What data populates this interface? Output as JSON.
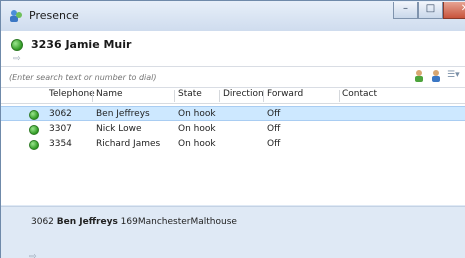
{
  "window": {
    "title": "Presence",
    "controls": {
      "minimize": "–",
      "maximize": "□",
      "close": "✕"
    }
  },
  "header": {
    "title": "3236 Jamie Muir",
    "status_color": "#36a62b"
  },
  "search": {
    "placeholder": "(Enter search text or number to dial)"
  },
  "table": {
    "columns": [
      "Telephone",
      "Name",
      "State",
      "Direction",
      "Forward",
      "Contact"
    ],
    "rows": [
      {
        "telephone": "3062",
        "name": "Ben Jeffreys",
        "state": "On hook",
        "direction": "",
        "forward": "Off",
        "contact": ""
      },
      {
        "telephone": "3307",
        "name": "Nick Lowe",
        "state": "On hook",
        "direction": "",
        "forward": "Off",
        "contact": ""
      },
      {
        "telephone": "3354",
        "name": "Richard James",
        "state": "On hook",
        "direction": "",
        "forward": "Off",
        "contact": ""
      }
    ]
  },
  "details": {
    "extension": "3062",
    "name": "Ben Jeffreys",
    "location": "169ManchesterMalthouse"
  },
  "icons": {
    "app": "presence-app-icon",
    "header": "phone-forward-icon",
    "user_green": "user-green-icon",
    "user_blue": "user-blue-icon",
    "menu": "list-menu-icon",
    "details": "phone-forward-icon"
  }
}
